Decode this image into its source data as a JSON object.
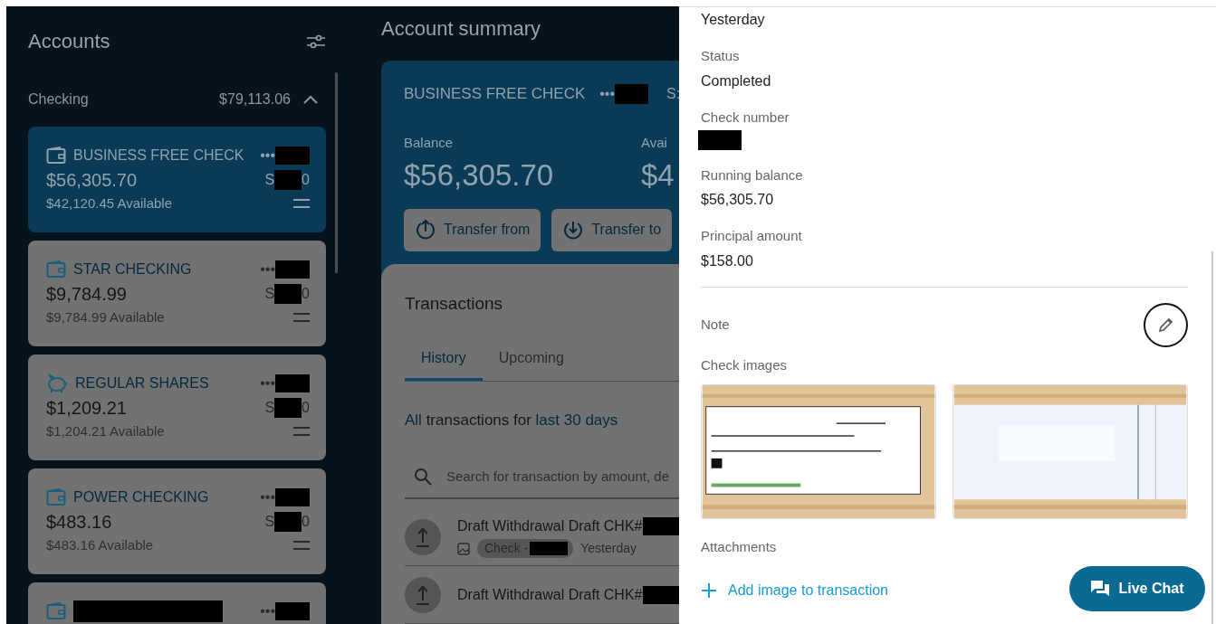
{
  "accounts_panel": {
    "title": "Accounts",
    "group": {
      "label": "Checking",
      "total": "$79,113.06",
      "expanded": true
    },
    "accounts": [
      {
        "kind": "wallet",
        "name": "BUSINESS FREE CHECK",
        "dots": "•••",
        "balance": "$56,305.70",
        "number_start": "S",
        "number_end": "0",
        "available": "$42,120.45 Available",
        "selected": true
      },
      {
        "kind": "wallet",
        "name": "STAR CHECKING",
        "dots": "•••",
        "balance": "$9,784.99",
        "number_start": "S",
        "number_end": "0",
        "available": "$9,784.99 Available",
        "selected": false
      },
      {
        "kind": "savings",
        "name": "REGULAR SHARES",
        "dots": "•••",
        "balance": "$1,209.21",
        "number_start": "S",
        "number_end": "0",
        "available": "$1,204.21 Available",
        "selected": false
      },
      {
        "kind": "wallet",
        "name": "POWER CHECKING",
        "dots": "•••",
        "balance": "$483.16",
        "number_start": "S",
        "number_end": "0",
        "available": "$483.16 Available",
        "selected": false
      },
      {
        "kind": "wallet",
        "dots": "•••",
        "selected": false
      }
    ]
  },
  "summary": {
    "title": "Account summary",
    "account_name": "BUSINESS FREE CHECK",
    "dots": "•••",
    "number_start": "S:",
    "balance_label": "Balance",
    "balance": "$56,305.70",
    "available_label": "Avai",
    "available": "$4",
    "buttons": [
      {
        "kind": "out",
        "label": "Transfer from"
      },
      {
        "kind": "in",
        "label": "Transfer to"
      }
    ]
  },
  "transactions": {
    "title": "Transactions",
    "tabs": [
      {
        "label": "History",
        "selected": true
      },
      {
        "label": "Upcoming",
        "selected": false
      }
    ],
    "filter": [
      {
        "text": "All",
        "link": true
      },
      {
        "text": " transactions for ",
        "link": false
      },
      {
        "text": "last 30 days",
        "link": true
      }
    ],
    "search": {
      "placeholder": "Search for transaction by amount, de"
    },
    "rows": [
      {
        "title": "Draft Withdrawal Draft CHK#",
        "tag": "Check -",
        "date": "Yesterday"
      },
      {
        "title": "Draft Withdrawal Draft CHK#"
      }
    ]
  },
  "details": {
    "top_value": "Yesterday",
    "fields": [
      {
        "label": "Status",
        "value": "Completed"
      },
      {
        "label": "Check number",
        "redacted": true
      },
      {
        "label": "Running balance",
        "value": "$56,305.70"
      },
      {
        "label": "Principal amount",
        "value": "$158.00"
      }
    ],
    "note_label": "Note",
    "images_label": "Check images",
    "attachments_label": "Attachments",
    "add_link": "Add image to transaction"
  },
  "live_chat": "Live Chat"
}
